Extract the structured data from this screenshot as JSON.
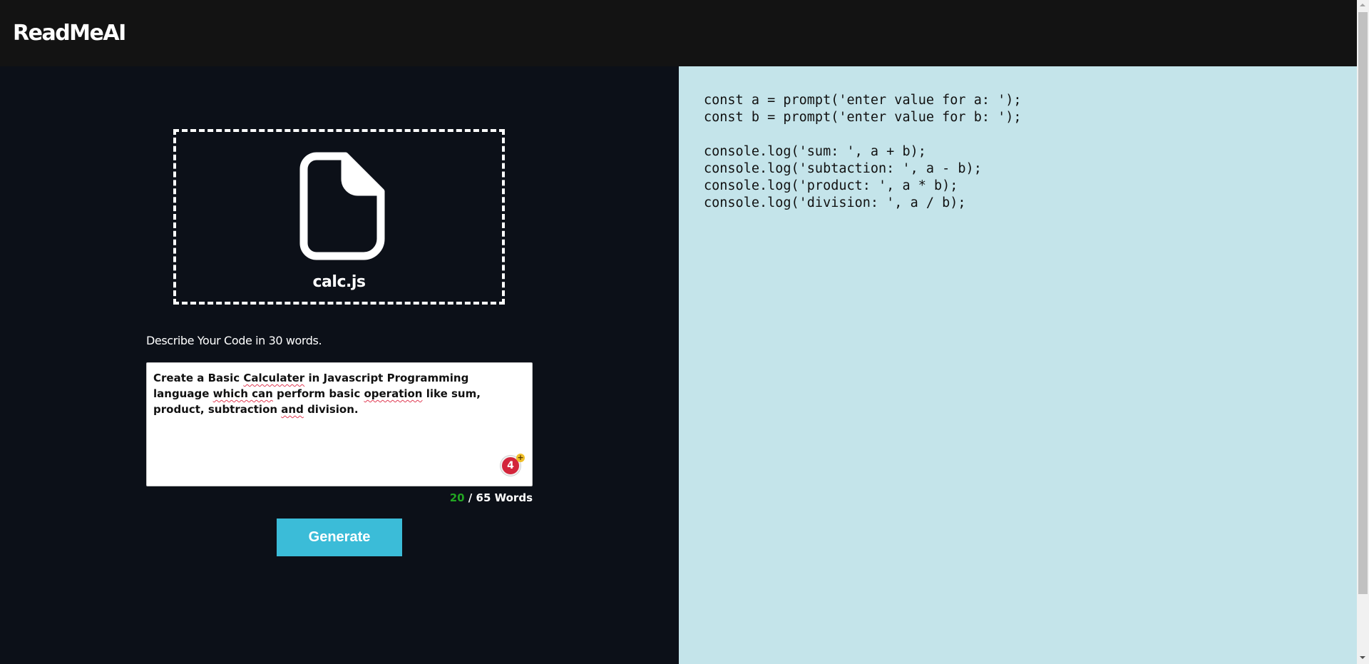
{
  "app": {
    "title": "ReadMeAI"
  },
  "upload": {
    "file_name": "calc.js",
    "icon": "file-icon"
  },
  "description": {
    "label": "Describe Your Code in 30 words.",
    "words": [
      " Create a Basic ",
      "Calculater",
      " in Javascript Programming language ",
      "which can",
      " perform basic ",
      "operation",
      " like sum, product, subtraction ",
      "and",
      " division."
    ],
    "grammar_badge_count": "4",
    "grammar_badge_plus": "+"
  },
  "word_count": {
    "current": "20",
    "separator": " / ",
    "max_label": "65 Words"
  },
  "generate_button": {
    "label": "Generate"
  },
  "code_preview": {
    "code": "const a = prompt('enter value for a: ');\nconst b = prompt('enter value for b: ');\n\nconsole.log('sum: ', a + b);\nconsole.log('subtaction: ', a - b);\nconsole.log('product: ', a * b);\nconsole.log('division: ', a / b);"
  },
  "colors": {
    "header_bg": "#131313",
    "left_bg": "#0c1018",
    "right_bg": "#c4e4ea",
    "accent": "#3bbcd8",
    "word_count_current": "#22a522",
    "badge": "#d3253b"
  }
}
